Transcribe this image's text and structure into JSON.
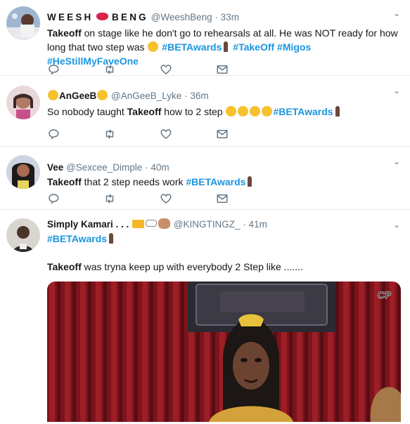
{
  "tweets": [
    {
      "name": "WEESH",
      "name_after": "BENG",
      "handle": "@WeeshBeng",
      "separator": "·",
      "time": "33m",
      "text_bold": "Takeoff",
      "text_1": " on stage like he don't go to rehearsals at all. He was NOT ready for how long that two step was ",
      "hashtags": [
        "#BETAwards",
        "#TakeOff",
        "#Migos",
        "#HeStillMyFaveOne"
      ]
    },
    {
      "name": "AnGeeB",
      "handle": "@AnGeeB_Lyke",
      "separator": "·",
      "time": "36m",
      "text_1": "So nobody taught ",
      "text_bold": "Takeoff",
      "text_2": " how to 2 step ",
      "hashtags": [
        "#BETAwards"
      ]
    },
    {
      "name": "Vee",
      "handle": "@Sexcee_Dimple",
      "separator": "·",
      "time": "40m",
      "text_bold": "Takeoff",
      "text_1": " that 2 step needs work ",
      "hashtags": [
        "#BETAwards"
      ]
    },
    {
      "name": "Simply Kamari . . .",
      "handle": "@KINGTINGZ_",
      "separator": "·",
      "time": "41m",
      "hashtags": [
        "#BETAwards"
      ],
      "text_bold": "Takeoff",
      "text_1": " was tryna keep up with everybody 2 Step like .......",
      "media_watermark": "CP"
    }
  ],
  "icons": {
    "reply": "reply-icon",
    "retweet": "retweet-icon",
    "like": "heart-icon",
    "message": "envelope-icon",
    "caret": "chevron-down-icon"
  },
  "colors": {
    "hashtag": "#1b95e0",
    "meta": "#657786",
    "divider": "#e6ecf0"
  }
}
